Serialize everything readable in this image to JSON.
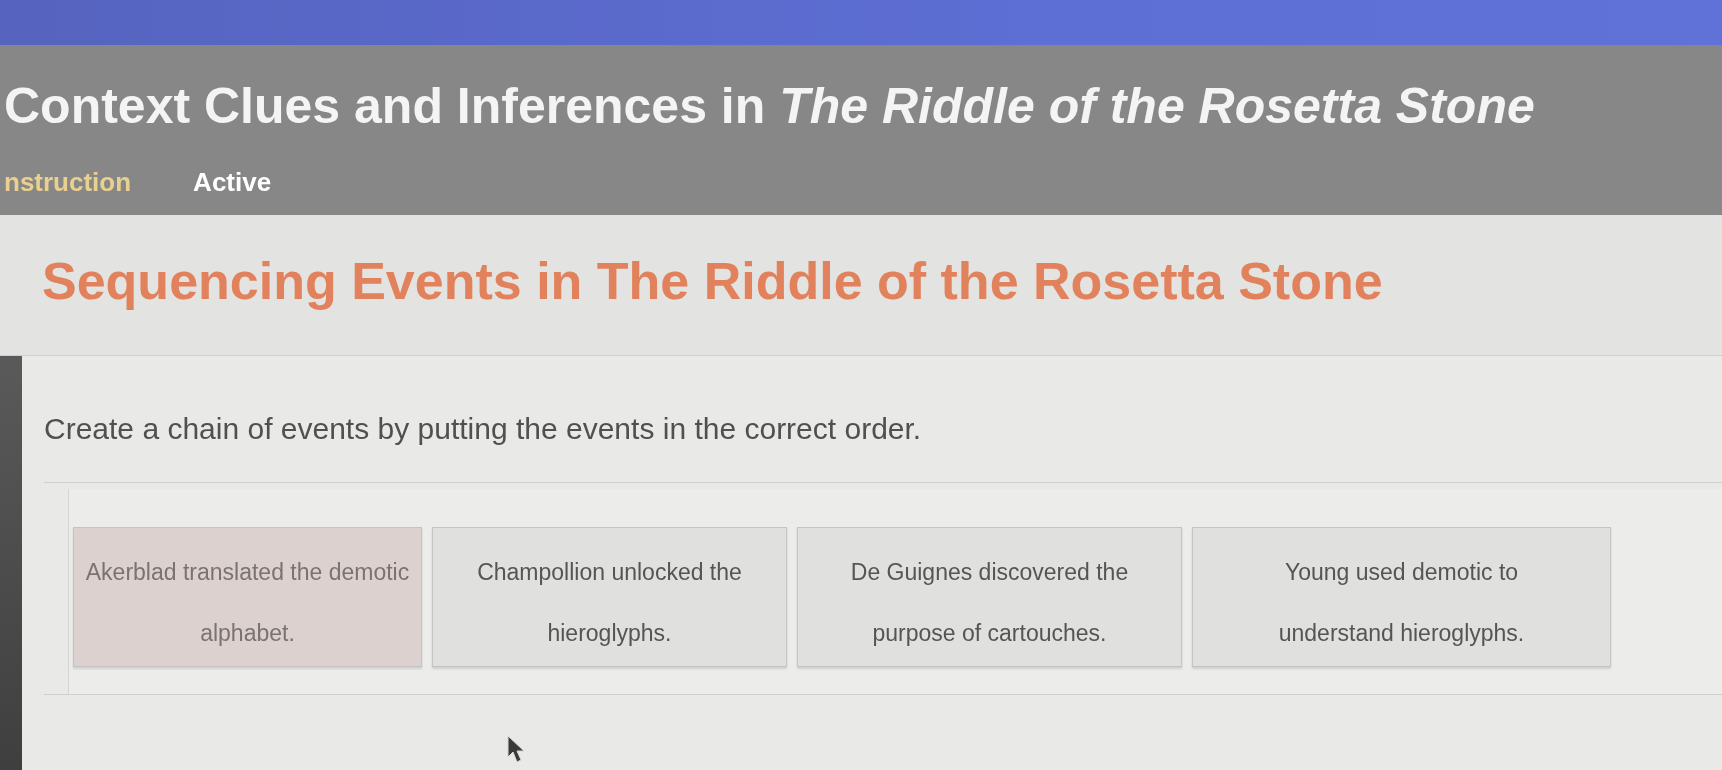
{
  "header": {
    "title": "Context Clues and Inferences in *The Riddle of the Rosetta Stone*",
    "tabs": [
      {
        "label": "nstruction",
        "selected": true
      },
      {
        "label": "Active",
        "selected": false
      }
    ]
  },
  "activity": {
    "heading": "Sequencing Events in The Riddle of the Rosetta Stone",
    "instructions": "Create a chain of events by putting the events in the correct order.",
    "events": [
      {
        "text": "Akerblad translated the demotic alphabet.",
        "selected": true
      },
      {
        "text": "Champollion unlocked the hieroglyphs.",
        "selected": false
      },
      {
        "text": "De Guignes discovered the purpose of cartouches.",
        "selected": false
      },
      {
        "text": "Young used demotic to understand hieroglyphs.",
        "selected": false
      }
    ]
  }
}
